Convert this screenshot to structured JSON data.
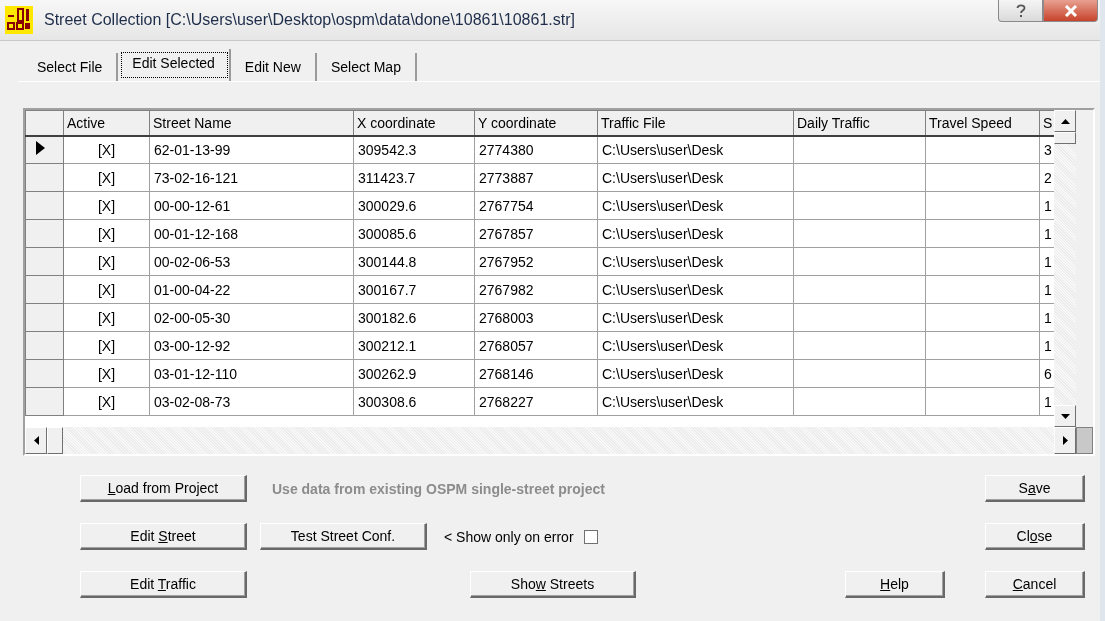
{
  "window": {
    "title": "Street Collection [C:\\Users\\user\\Desktop\\ospm\\data\\done\\10861\\10861.str]"
  },
  "tabs": [
    {
      "label": "Select File",
      "selected": false
    },
    {
      "label": "Edit Selected",
      "selected": true
    },
    {
      "label": "Edit New",
      "selected": false
    },
    {
      "label": "Select Map",
      "selected": false
    }
  ],
  "table": {
    "columns": [
      "Active",
      "Street Name",
      "X  coordinate",
      "Y  coordinate",
      "Traffic File",
      "Daily Traffic",
      "Travel Speed",
      "S"
    ],
    "rows": [
      {
        "selected": true,
        "cells": [
          "[X]",
          "62-01-13-99",
          "309542.3",
          "2774380",
          "C:\\Users\\user\\Desk",
          "",
          "",
          "3"
        ]
      },
      {
        "selected": false,
        "cells": [
          "[X]",
          "73-02-16-121",
          "311423.7",
          "2773887",
          "C:\\Users\\user\\Desk",
          "",
          "",
          "2"
        ]
      },
      {
        "selected": false,
        "cells": [
          "[X]",
          "00-00-12-61",
          "300029.6",
          "2767754",
          "C:\\Users\\user\\Desk",
          "",
          "",
          "1"
        ]
      },
      {
        "selected": false,
        "cells": [
          "[X]",
          "00-01-12-168",
          "300085.6",
          "2767857",
          "C:\\Users\\user\\Desk",
          "",
          "",
          "1"
        ]
      },
      {
        "selected": false,
        "cells": [
          "[X]",
          "00-02-06-53",
          "300144.8",
          "2767952",
          "C:\\Users\\user\\Desk",
          "",
          "",
          "1"
        ]
      },
      {
        "selected": false,
        "cells": [
          "[X]",
          "01-00-04-22",
          "300167.7",
          "2767982",
          "C:\\Users\\user\\Desk",
          "",
          "",
          "1"
        ]
      },
      {
        "selected": false,
        "cells": [
          "[X]",
          "02-00-05-30",
          "300182.6",
          "2768003",
          "C:\\Users\\user\\Desk",
          "",
          "",
          "1"
        ]
      },
      {
        "selected": false,
        "cells": [
          "[X]",
          "03-00-12-92",
          "300212.1",
          "2768057",
          "C:\\Users\\user\\Desk",
          "",
          "",
          "1"
        ]
      },
      {
        "selected": false,
        "cells": [
          "[X]",
          "03-01-12-110",
          "300262.9",
          "2768146",
          "C:\\Users\\user\\Desk",
          "",
          "",
          "6"
        ]
      },
      {
        "selected": false,
        "cells": [
          "[X]",
          "03-02-08-73",
          "300308.6",
          "2768227",
          "C:\\Users\\user\\Desk",
          "",
          "",
          "1"
        ]
      }
    ]
  },
  "actions": {
    "load_project": {
      "key": "L",
      "post": "oad from Project"
    },
    "description": "Use data from existing OSPM single-street project",
    "edit_street": {
      "pre": "Edit ",
      "key": "S",
      "post": "treet"
    },
    "test_street": {
      "pre": "Test Street Conf."
    },
    "show_only_on_error": {
      "label": "< Show only on error",
      "checked": false
    },
    "edit_traffic": {
      "pre": "Edit ",
      "key": "T",
      "post": "raffic"
    },
    "show_streets": {
      "pre": "Sho",
      "key": "w",
      "post": " Streets"
    },
    "help": {
      "key": "H",
      "post": "elp"
    },
    "save": {
      "pre": "S",
      "key": "a",
      "post": "ve"
    },
    "close": {
      "pre": "Cl",
      "key": "o",
      "post": "se"
    },
    "cancel": {
      "key": "C",
      "post": "ancel"
    }
  }
}
